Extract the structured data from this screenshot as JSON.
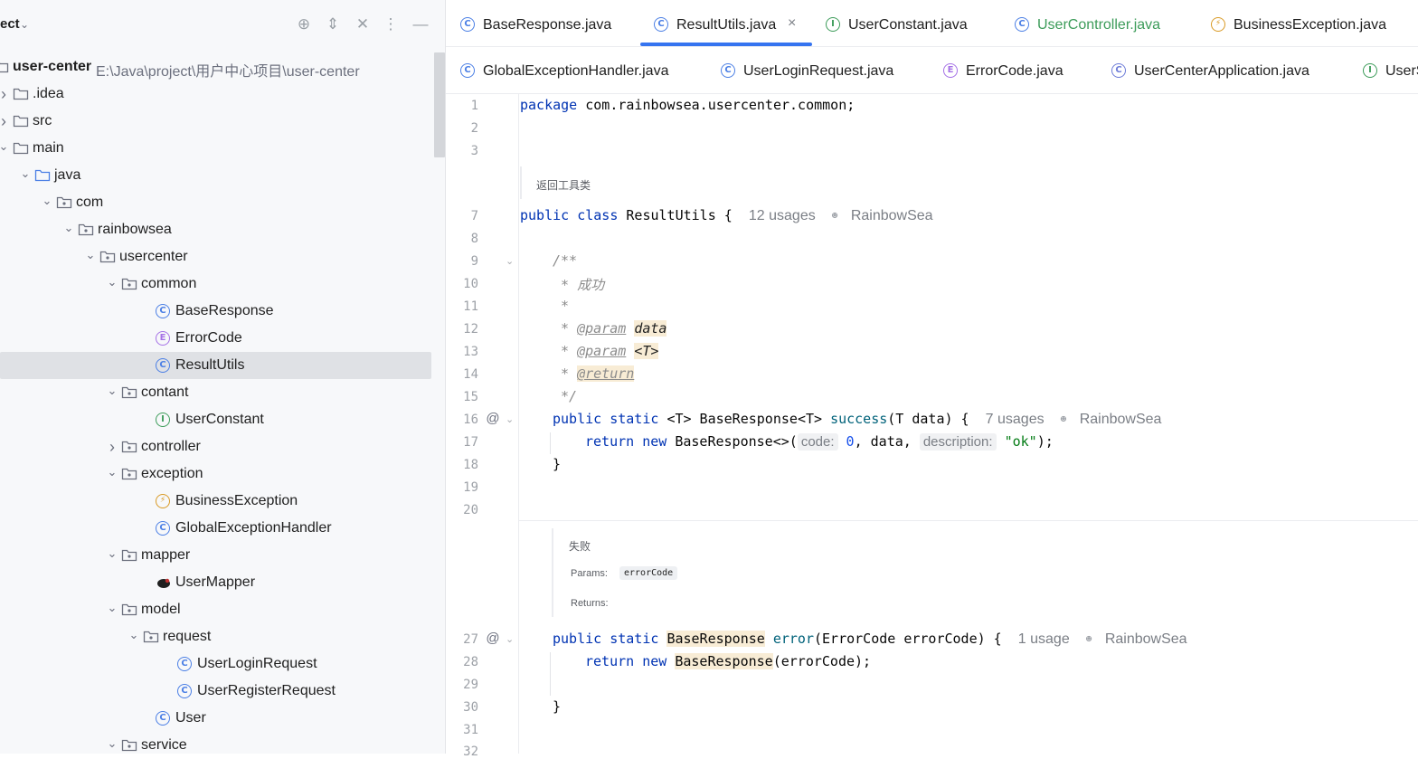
{
  "project_panel": {
    "title": "ect",
    "tree": [
      {
        "label": "user-center",
        "path": "E:\\Java\\project\\用户中心项目\\user-center",
        "type": "module",
        "expanded": true,
        "bold": true
      },
      {
        "label": ".idea",
        "type": "folder"
      },
      {
        "label": "src",
        "type": "folder"
      },
      {
        "label": "main",
        "type": "folder",
        "expanded": true
      },
      {
        "label": "java",
        "type": "source-folder",
        "expanded": true
      },
      {
        "label": "com",
        "type": "package",
        "expanded": true
      },
      {
        "label": "rainbowsea",
        "type": "package",
        "expanded": true
      },
      {
        "label": "usercenter",
        "type": "package",
        "expanded": true
      },
      {
        "label": "common",
        "type": "package",
        "expanded": true
      },
      {
        "label": "BaseResponse",
        "type": "class"
      },
      {
        "label": "ErrorCode",
        "type": "enum"
      },
      {
        "label": "ResultUtils",
        "type": "class",
        "selected": true
      },
      {
        "label": "contant",
        "type": "package",
        "expanded": true
      },
      {
        "label": "UserConstant",
        "type": "interface"
      },
      {
        "label": "controller",
        "type": "package",
        "expanded": false
      },
      {
        "label": "exception",
        "type": "package",
        "expanded": true
      },
      {
        "label": "BusinessException",
        "type": "exception"
      },
      {
        "label": "GlobalExceptionHandler",
        "type": "class"
      },
      {
        "label": "mapper",
        "type": "package",
        "expanded": true
      },
      {
        "label": "UserMapper",
        "type": "mapper"
      },
      {
        "label": "model",
        "type": "package",
        "expanded": true
      },
      {
        "label": "request",
        "type": "package",
        "expanded": true
      },
      {
        "label": "UserLoginRequest",
        "type": "class"
      },
      {
        "label": "UserRegisterRequest",
        "type": "class"
      },
      {
        "label": "User",
        "type": "class"
      },
      {
        "label": "service",
        "type": "package",
        "expanded": true
      }
    ]
  },
  "tabs_row1": [
    {
      "label": "BaseResponse.java",
      "icon": "class-icon"
    },
    {
      "label": "ResultUtils.java",
      "icon": "class-icon",
      "active": true,
      "close": "×"
    },
    {
      "label": "UserConstant.java",
      "icon": "interface-icon"
    },
    {
      "label": "UserController.java",
      "icon": "class-icon",
      "modified": true
    },
    {
      "label": "BusinessException.java",
      "icon": "exception-icon"
    }
  ],
  "tabs_row2": [
    {
      "label": "GlobalExceptionHandler.java",
      "icon": "class-icon"
    },
    {
      "label": "UserLoginRequest.java",
      "icon": "class-icon"
    },
    {
      "label": "ErrorCode.java",
      "icon": "enum-icon"
    },
    {
      "label": "UserCenterApplication.java",
      "icon": "spring-class-icon"
    },
    {
      "label": "UserS",
      "icon": "interface-icon"
    }
  ],
  "editor": {
    "line_numbers": [
      "1",
      "2",
      "3",
      "7",
      "8",
      "9",
      "10",
      "11",
      "12",
      "13",
      "14",
      "15",
      "16",
      "17",
      "18",
      "19",
      "20",
      "27",
      "28",
      "29",
      "30",
      "31",
      "32"
    ],
    "code": {
      "l1_kw": "package",
      "l1_rest": " com.rainbowsea.usercenter.common;",
      "doc1": "返回工具类",
      "l7_kw": "public class",
      "l7_rest": " ResultUtils {",
      "l7_usages": "12 usages",
      "author": "RainbowSea",
      "l9": "/**",
      "l10": " * 成功",
      "l11": " *",
      "l12_star": " * ",
      "l12_tag": "@param",
      "l12_val": "data",
      "l13_tag": "@param",
      "l13_val": "<T>",
      "l14_tag": "@return",
      "l15": " */",
      "l16_kw": "public static",
      "l16_t1": "<T>",
      "l16_type": " BaseResponse",
      "l16_t2": "<T>",
      "l16_fn": "success",
      "l16_params": "(T data) {",
      "l16_usages": "7 usages",
      "l17_kw": "return new",
      "l17_type": " BaseResponse<>(",
      "l17_hint1": "code:",
      "l17_num": "0",
      "l17_mid": ", data, ",
      "l17_hint2": "description:",
      "l17_str": "\"ok\"",
      "l17_end": ");",
      "l18": "}",
      "doc2_title": "失败",
      "doc2_params_label": "Params:",
      "doc2_param": "errorCode",
      "doc2_returns_label": "Returns:",
      "l27_kw": "public static",
      "l27_type": "BaseResponse",
      "l27_fn": "error",
      "l27_params": "(ErrorCode errorCode) {",
      "l27_usages": "1 usage",
      "l28_kw": "return new",
      "l28_type": "BaseResponse",
      "l28_rest": "(errorCode);",
      "l30": "}"
    }
  },
  "colors": {
    "accent": "#3574f0",
    "keyword": "#0033b3",
    "selection": "#dfe1e5"
  }
}
